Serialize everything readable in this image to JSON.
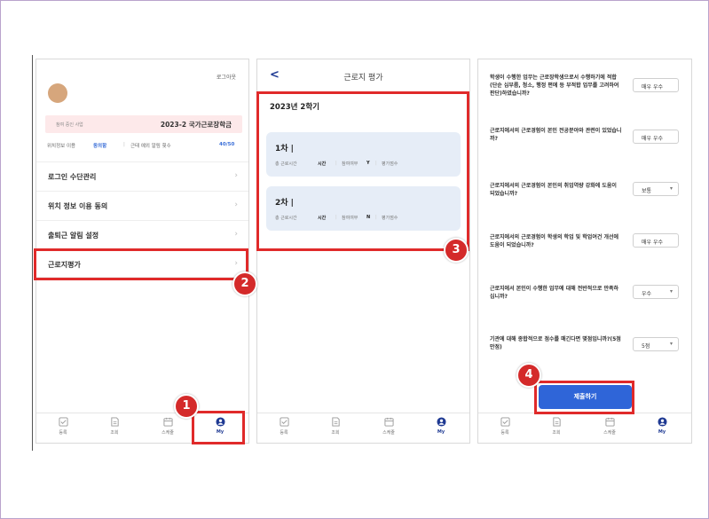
{
  "screen1": {
    "logout": "로그아웃",
    "card_label": "참여 중인 사업",
    "card_value": "2023-2 국가근로장학금",
    "status": {
      "location_label": "위치정보 이용",
      "location_value": "동의함",
      "commute_label": "근태 예외 알림 횟수",
      "commute_value": "40/50"
    },
    "menu": [
      "로그인 수단관리",
      "위치 정보 이용 동의",
      "출퇴근 알림 설정",
      "근로지평가"
    ]
  },
  "screen2": {
    "title": "근로지 평가",
    "semester": "2023년 2학기",
    "rounds": [
      {
        "title": "1차 |",
        "hours_label": "총 근로시간",
        "hours_value": "시간",
        "eval_label": "참여여부",
        "eval_value": "Y",
        "score_label": "평가점수"
      },
      {
        "title": "2차 |",
        "hours_label": "총 근로시간",
        "hours_value": "시간",
        "eval_label": "참여여부",
        "eval_value": "N",
        "score_label": "평가점수"
      }
    ]
  },
  "screen3": {
    "questions": [
      {
        "text": "학생이 수행한 업무는 근로장학생으로서 수행하기에 적합(단순 심부름, 청소, 행정 편에 등 부적합 업무를 고려하여 판단)하였습니까?",
        "answer": "매우 우수"
      },
      {
        "text": "근로지에서의 근로경험이 본인 전공분야와 관련이 있었습니까?",
        "answer": "매우 우수"
      },
      {
        "text": "근로지에서의 근로경험이 본인의 취업역량 강화에 도움이 되었습니까?",
        "answer": "보통"
      },
      {
        "text": "근로지에서의 근로경험이 학생의 학업 및 학업여건 개선에 도움이 되었습니까?",
        "answer": "매우 우수"
      },
      {
        "text": "근로지에서 본인이 수행한 업무에 대해 전반적으로 만족하십니까?",
        "answer": "우수"
      },
      {
        "text": "기관에 대해 종합적으로 점수를 매긴다면 몇점입니까?(5점 만점)",
        "answer": "5점"
      }
    ],
    "submit": "제출하기"
  },
  "tabs": [
    "등록",
    "조회",
    "스케줄",
    "My"
  ],
  "badges": [
    "1",
    "2",
    "3",
    "4"
  ],
  "colors": {
    "highlight": "#e02a2a",
    "primary": "#2f65d8",
    "nav_active": "#1f3a93"
  }
}
